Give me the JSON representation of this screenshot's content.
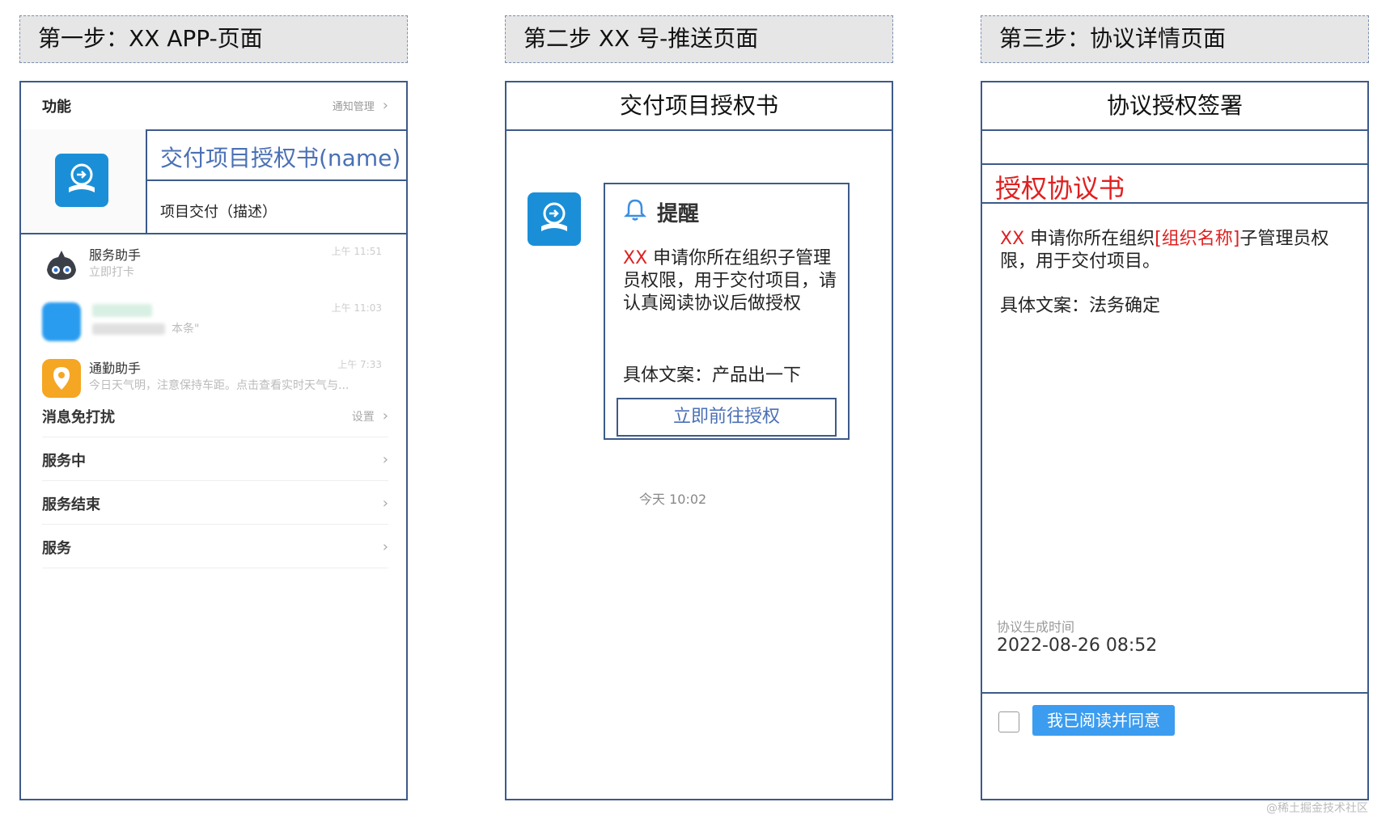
{
  "steps": [
    {
      "header": "第一步：XX APP-页面"
    },
    {
      "header": "第二步  XX 号-推送页面"
    },
    {
      "header": "第三步：协议详情页面"
    }
  ],
  "app": {
    "function_label": "功能",
    "notify_manage": "通知管理",
    "card_name": "交付项目授权书(name)",
    "card_desc": "项目交付（描述）",
    "list": [
      {
        "title": "服务助手",
        "sub": "立即打卡",
        "time": "上午 11:51"
      },
      {
        "title": "",
        "sub": "本条\"",
        "time": "上午 11:03"
      },
      {
        "title": "通勤助手",
        "sub": "今日天气明，注意保持车距。点击查看实时天气与...",
        "time": "上午 7:33"
      }
    ],
    "dnd": {
      "label": "消息免打扰",
      "right": "设置"
    },
    "menu": [
      "服务中",
      "服务结束",
      "服务"
    ]
  },
  "push": {
    "title": "交付项目授权书",
    "remind_title": "提醒",
    "body_red": "XX",
    "body_text": " 申请你所在组织子管理员权限，用于交付项目，请认真阅读协议后做授权",
    "copy": "具体文案：产品出一下",
    "button": "立即前往授权",
    "time": "今天 10:02"
  },
  "agreement": {
    "title": "协议授权签署",
    "doc_title": "授权协议书",
    "body_red1": "XX",
    "body_mid": " 申请你所在组织",
    "body_red2": "[组织名称]",
    "body_tail": "子管理员权限，用于交付项目。",
    "copy": "具体文案：法务确定",
    "gen_label": "协议生成时间",
    "gen_time": "2022-08-26 08:52",
    "agree_button": "我已阅读并同意"
  },
  "watermark": "@稀土掘金技术社区",
  "colors": {
    "frame_border": "#3d5a8a",
    "accent_blue": "#4a70b5",
    "red": "#e02020",
    "button_blue": "#3b9cf0",
    "app_icon": "#1a8fd8"
  }
}
